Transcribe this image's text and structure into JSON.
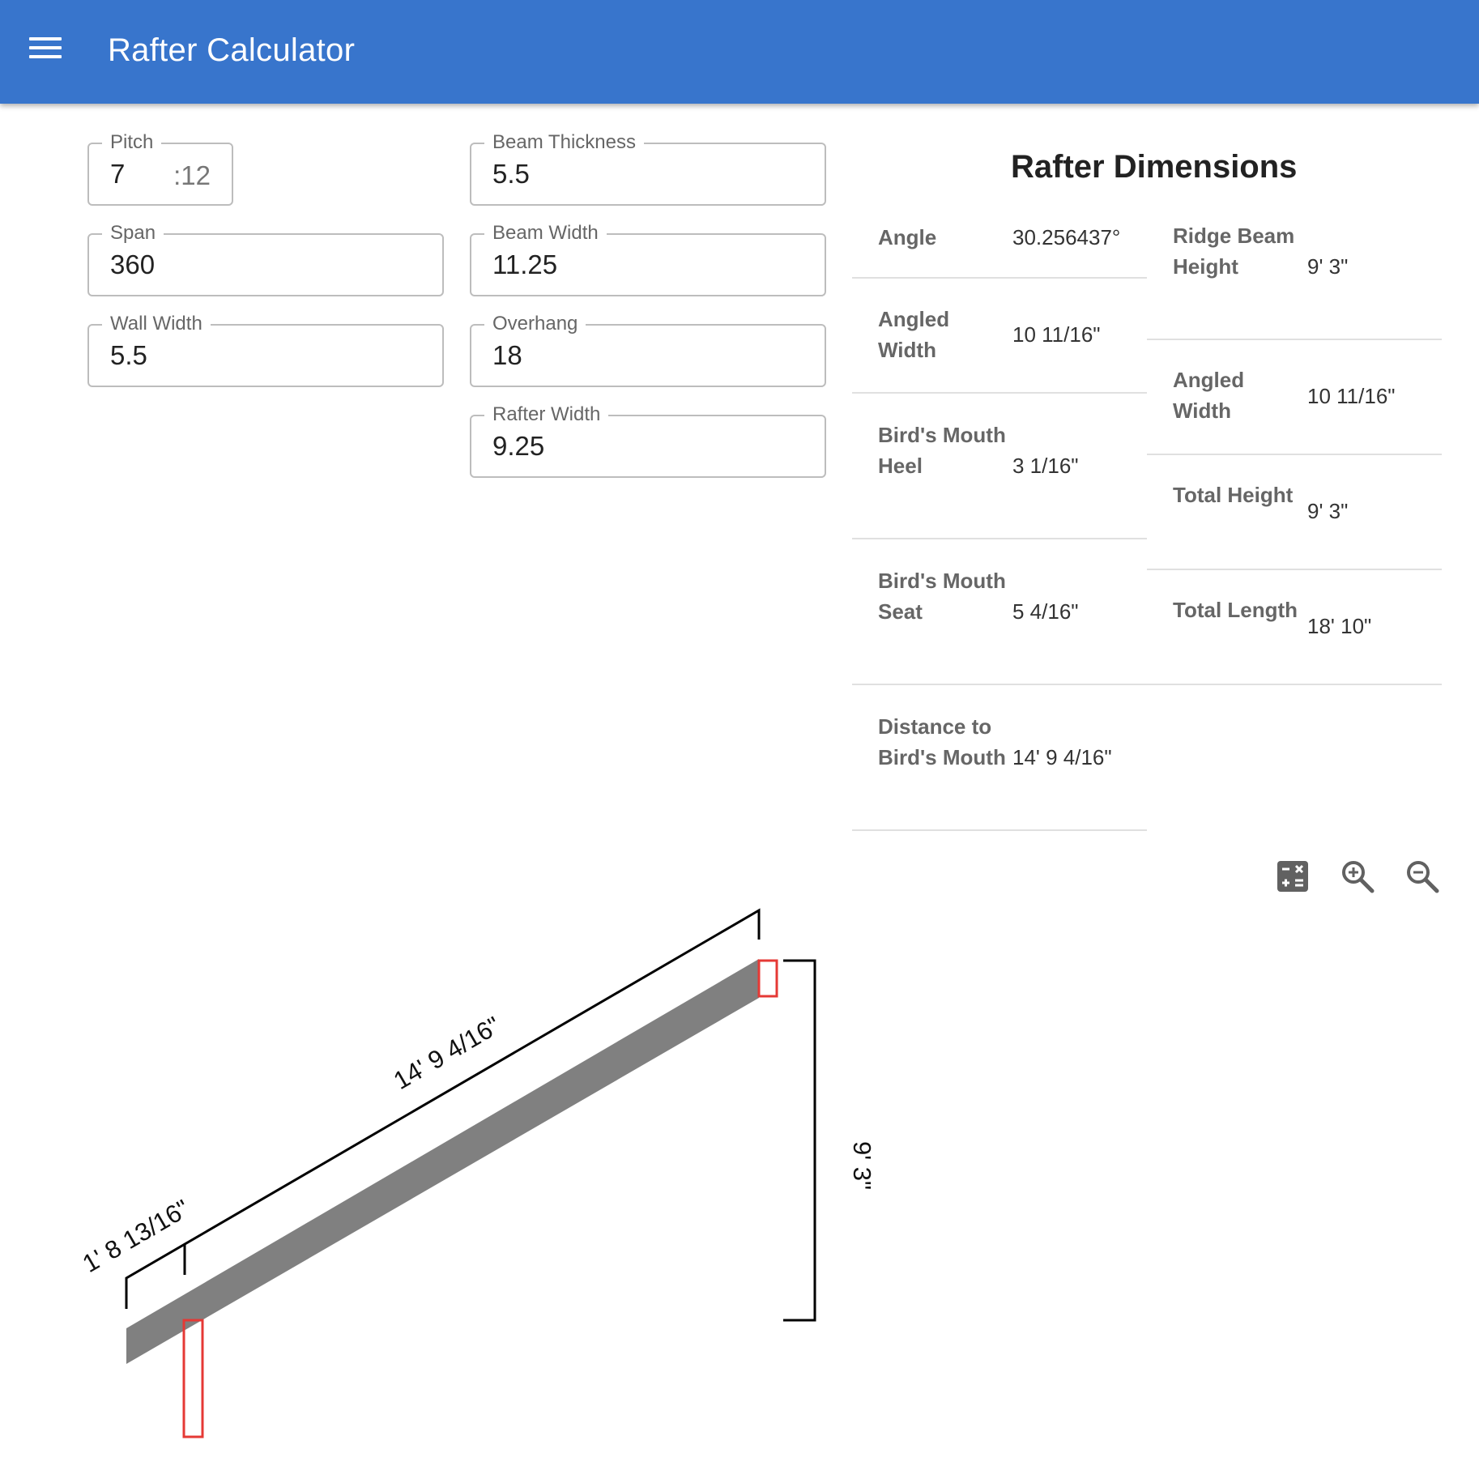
{
  "app": {
    "title": "Rafter Calculator",
    "menu_icon": "menu-icon"
  },
  "inputs": {
    "pitch": {
      "label": "Pitch",
      "value": "7",
      "suffix": ":12"
    },
    "span": {
      "label": "Span",
      "value": "360"
    },
    "wall_width": {
      "label": "Wall Width",
      "value": "5.5"
    },
    "beam_thickness": {
      "label": "Beam Thickness",
      "value": "5.5"
    },
    "beam_width": {
      "label": "Beam Width",
      "value": "11.25"
    },
    "overhang": {
      "label": "Overhang",
      "value": "18"
    },
    "rafter_width": {
      "label": "Rafter Width",
      "value": "9.25"
    }
  },
  "results": {
    "title": "Rafter Dimensions",
    "left": [
      {
        "label": "Angle",
        "value": "30.256437°"
      },
      {
        "label": "Angled Width",
        "value": "10 11/16\""
      },
      {
        "label": "Bird's Mouth Heel",
        "value": "3 1/16\""
      },
      {
        "label": "Bird's Mouth Seat",
        "value": "5 4/16\""
      },
      {
        "label": "Distance to Bird's Mouth",
        "value": "14' 9 4/16\""
      }
    ],
    "right": [
      {
        "label": "Ridge Beam Height",
        "value": "9' 3\""
      },
      {
        "label": "Angled Width",
        "value": "10 11/16\""
      },
      {
        "label": "Total Height",
        "value": "9' 3\""
      },
      {
        "label": "Total Length",
        "value": "18' 10\""
      }
    ]
  },
  "toolbar": {
    "icons": [
      "calculator-icon",
      "zoom-in-icon",
      "zoom-out-icon"
    ]
  },
  "diagram": {
    "overhang_length": "1'  8 13/16\"",
    "rafter_length": "14'  9 4/16\"",
    "height": "9' 3\"",
    "rafter_color": "#808080",
    "beam_outline_color": "#e53935"
  }
}
